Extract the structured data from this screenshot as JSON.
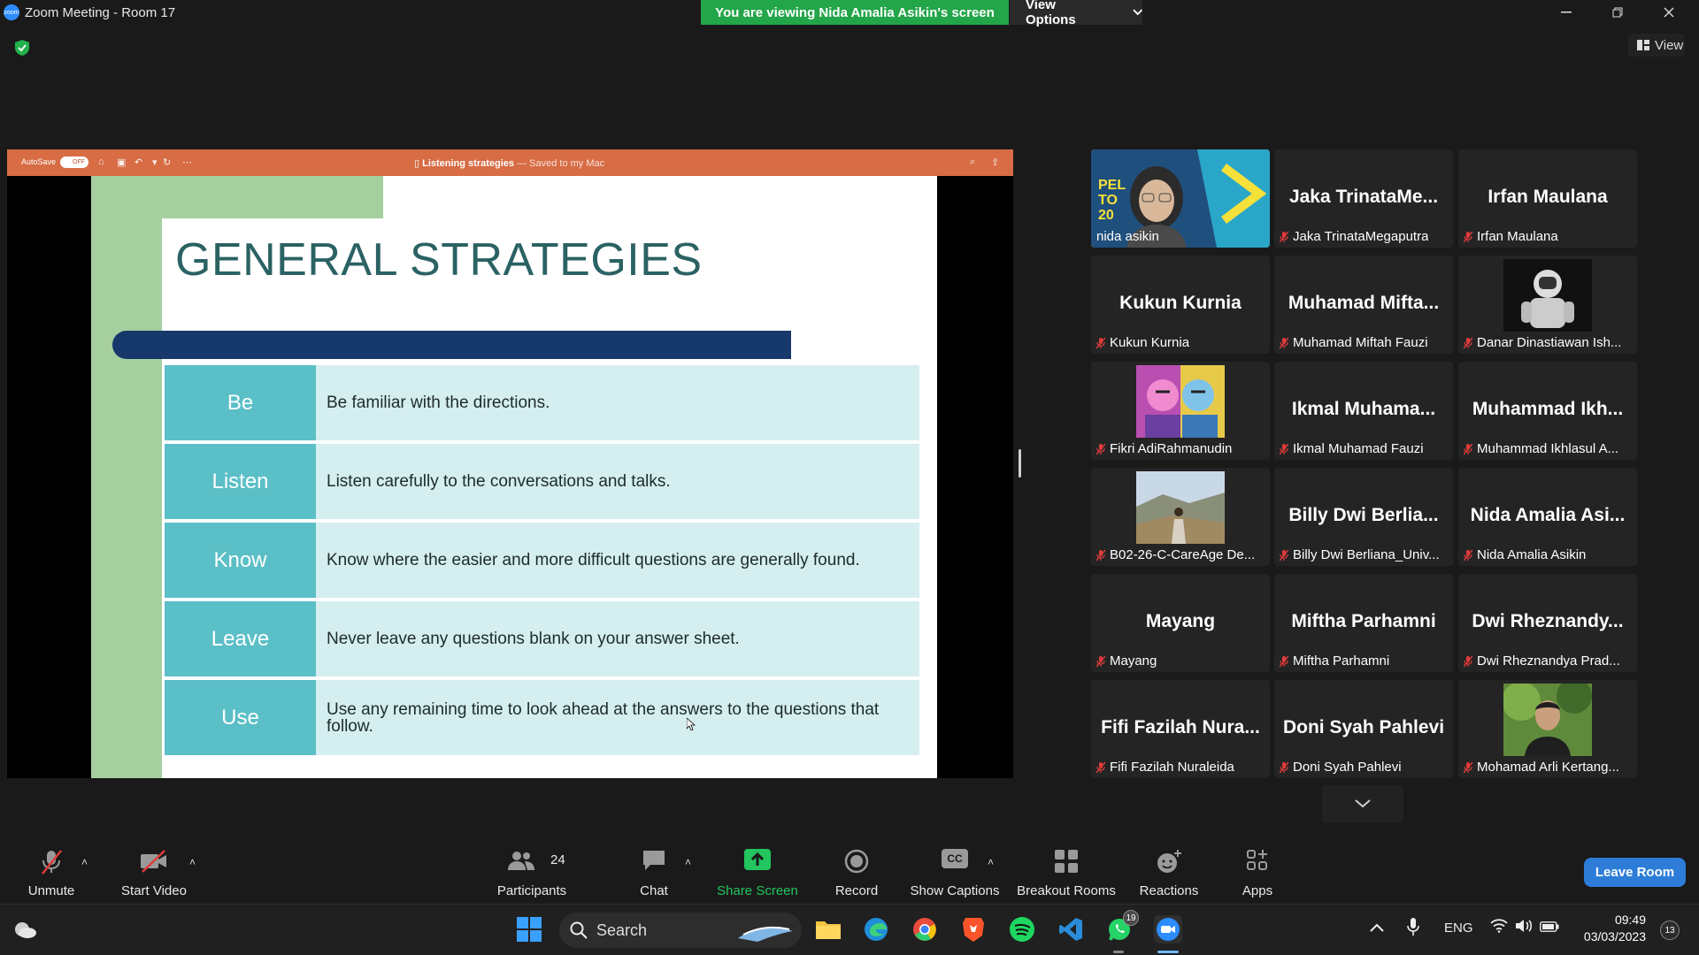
{
  "window": {
    "title": "Zoom Meeting - Room 17",
    "viewing_banner": "You are viewing Nida Amalia Asikin's screen",
    "view_options": "View Options",
    "view_button": "View"
  },
  "shared": {
    "autosave_label": "AutoSave",
    "autosave_state": "OFF",
    "doc_title": "Listening strategies",
    "doc_subtitle": "— Saved to my Mac",
    "slide_title": "GENERAL STRATEGIES",
    "rows": [
      {
        "key": "Be",
        "text": "Be familiar with the directions."
      },
      {
        "key": "Listen",
        "text": "Listen carefully to the conversations and talks."
      },
      {
        "key": "Know",
        "text": "Know where the easier and more difficult questions are generally found."
      },
      {
        "key": "Leave",
        "text": "Never leave any questions blank on your answer sheet."
      },
      {
        "key": "Use",
        "text": "Use any remaining time to look ahead at the answers to the questions that follow."
      }
    ]
  },
  "participants": [
    {
      "big": "",
      "name": "nida asikin"
    },
    {
      "big": "Jaka TrinataMe...",
      "name": "Jaka TrinataMegaputra"
    },
    {
      "big": "Irfan Maulana",
      "name": "Irfan Maulana"
    },
    {
      "big": "Kukun Kurnia",
      "name": "Kukun Kurnia"
    },
    {
      "big": "Muhamad Mifta...",
      "name": "Muhamad Miftah Fauzi"
    },
    {
      "big": "",
      "name": "Danar Dinastiawan Ish..."
    },
    {
      "big": "",
      "name": "Fikri AdiRahmanudin"
    },
    {
      "big": "Ikmal Muhama...",
      "name": "Ikmal Muhamad Fauzi"
    },
    {
      "big": "Muhammad Ikh...",
      "name": "Muhammad Ikhlasul A..."
    },
    {
      "big": "",
      "name": "B02-26-C-CareAge De..."
    },
    {
      "big": "Billy Dwi Berlia...",
      "name": "Billy Dwi Berliana_Univ..."
    },
    {
      "big": "Nida Amalia Asi...",
      "name": "Nida Amalia Asikin"
    },
    {
      "big": "Mayang",
      "name": "Mayang"
    },
    {
      "big": "Miftha Parhamni",
      "name": "Miftha Parhamni"
    },
    {
      "big": "Dwi Rheznandy...",
      "name": "Dwi Rheznandya Prad..."
    },
    {
      "big": "Fifi Fazilah Nura...",
      "name": "Fifi Fazilah Nuraleida"
    },
    {
      "big": "Doni Syah Pahlevi",
      "name": "Doni Syah Pahlevi"
    },
    {
      "big": "",
      "name": "Mohamad Arli Kertang..."
    }
  ],
  "toolbar": {
    "unmute": "Unmute",
    "start_video": "Start Video",
    "participants": "Participants",
    "participants_count": "24",
    "chat": "Chat",
    "share_screen": "Share Screen",
    "record": "Record",
    "show_captions": "Show Captions",
    "captions_badge": "CC",
    "breakout_rooms": "Breakout Rooms",
    "reactions": "Reactions",
    "apps": "Apps",
    "leave_room": "Leave Room"
  },
  "taskbar": {
    "search": "Search",
    "language": "ENG",
    "time": "09:49",
    "date": "03/03/2023",
    "whatsapp_badge": "19",
    "notif_count": "13"
  },
  "colors": {
    "banner_green": "#23a549",
    "ppt_orange": "#d76c45",
    "slide_teal": "#5bbfc7",
    "slide_navy": "#16386a",
    "leave_blue": "#2d7dd8"
  }
}
